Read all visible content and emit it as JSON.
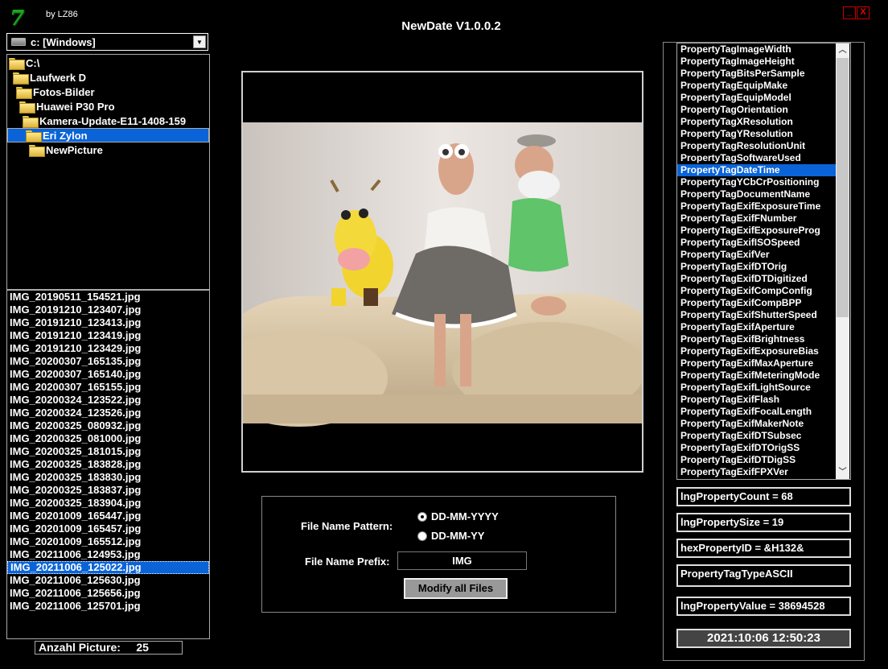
{
  "app": {
    "logo": "7",
    "byline": "by LZ86",
    "title": "NewDate V1.0.0.2",
    "minimize": "_",
    "close": "X"
  },
  "drive": {
    "label": "c: [Windows]"
  },
  "tree": [
    {
      "label": "C:\\"
    },
    {
      "label": "Laufwerk  D"
    },
    {
      "label": "Fotos-Bilder"
    },
    {
      "label": "Huawei P30 Pro"
    },
    {
      "label": "Kamera-Update-E11-1408-159"
    },
    {
      "label": "Eri Zylon"
    },
    {
      "label": "NewPicture"
    }
  ],
  "files": [
    "IMG_20190511_154521.jpg",
    "IMG_20191210_123407.jpg",
    "IMG_20191210_123413.jpg",
    "IMG_20191210_123419.jpg",
    "IMG_20191210_123429.jpg",
    "IMG_20200307_165135.jpg",
    "IMG_20200307_165140.jpg",
    "IMG_20200307_165155.jpg",
    "IMG_20200324_123522.jpg",
    "IMG_20200324_123526.jpg",
    "IMG_20200325_080932.jpg",
    "IMG_20200325_081000.jpg",
    "IMG_20200325_181015.jpg",
    "IMG_20200325_183828.jpg",
    "IMG_20200325_183830.jpg",
    "IMG_20200325_183837.jpg",
    "IMG_20200325_183904.jpg",
    "IMG_20201009_165447.jpg",
    "IMG_20201009_165457.jpg",
    "IMG_20201009_165512.jpg",
    "IMG_20211006_124953.jpg",
    "IMG_20211006_125022.jpg",
    "IMG_20211006_125630.jpg",
    "IMG_20211006_125656.jpg",
    "IMG_20211006_125701.jpg"
  ],
  "selected_file": "IMG_20211006_125022.jpg",
  "count": {
    "label": "Anzahl Picture:",
    "value": "25"
  },
  "controls": {
    "pattern_label": "File Name Pattern:",
    "option1": "DD-MM-YYYY",
    "option2": "DD-MM-YY",
    "prefix_label": "File Name Prefix:",
    "prefix_value": "IMG",
    "modify_button": "Modify all Files"
  },
  "properties": [
    "PropertyTagImageWidth",
    "PropertyTagImageHeight",
    "PropertyTagBitsPerSample",
    "PropertyTagEquipMake",
    "PropertyTagEquipModel",
    "PropertyTagOrientation",
    "PropertyTagXResolution",
    "PropertyTagYResolution",
    "PropertyTagResolutionUnit",
    "PropertyTagSoftwareUsed",
    "PropertyTagDateTime",
    "PropertyTagYCbCrPositioning",
    "PropertyTagDocumentName",
    "PropertyTagExifExposureTime",
    "PropertyTagExifFNumber",
    "PropertyTagExifExposureProg",
    "PropertyTagExifISOSpeed",
    "PropertyTagExifVer",
    "PropertyTagExifDTOrig",
    "PropertyTagExifDTDigitized",
    "PropertyTagExifCompConfig",
    "PropertyTagExifCompBPP",
    "PropertyTagExifShutterSpeed",
    "PropertyTagExifAperture",
    "PropertyTagExifBrightness",
    "PropertyTagExifExposureBias",
    "PropertyTagExifMaxAperture",
    "PropertyTagExifMeteringMode",
    "PropertyTagExifLightSource",
    "PropertyTagExifFlash",
    "PropertyTagExifFocalLength",
    "PropertyTagExifMakerNote",
    "PropertyTagExifDTSubsec",
    "PropertyTagExifDTOrigSS",
    "PropertyTagExifDTDigSS",
    "PropertyTagExifFPXVer"
  ],
  "selected_property": "PropertyTagDateTime",
  "info": {
    "count": "lngPropertyCount = 68",
    "size": "lngPropertySize = 19",
    "id": "hexPropertyID = &H132&",
    "type": "PropertyTagTypeASCII",
    "value": "lngPropertyValue = 38694528",
    "datetime": "2021:10:06 12:50:23"
  },
  "colors": {
    "selection": "#0a64d8",
    "background": "#000000",
    "logo": "#1ea51e",
    "close": "#e00000"
  },
  "icons": {
    "folder": "folder-icon",
    "drive": "drive-icon",
    "dropdown": "chevron-down-icon"
  }
}
